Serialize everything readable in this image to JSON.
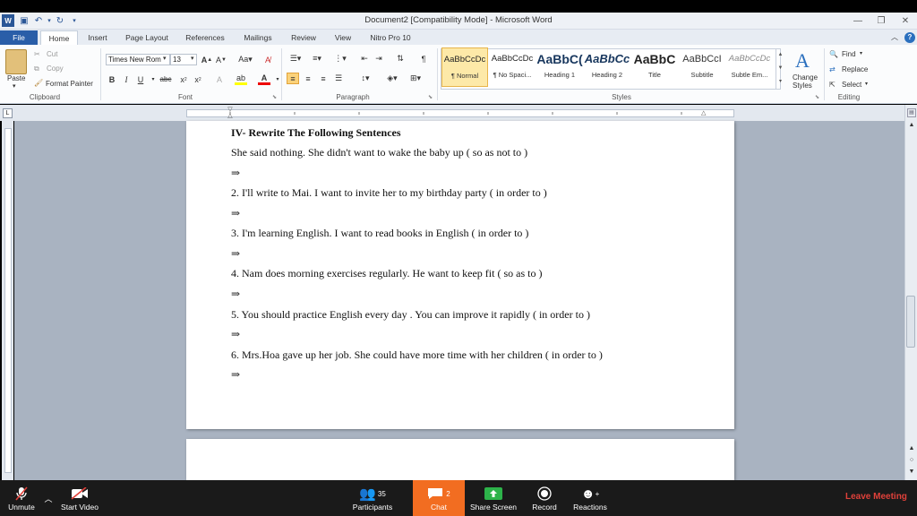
{
  "window": {
    "title": "Document2 [Compatibility Mode] - Microsoft Word"
  },
  "ribbon": {
    "tabs": [
      "File",
      "Home",
      "Insert",
      "Page Layout",
      "References",
      "Mailings",
      "Review",
      "View",
      "Nitro Pro 10"
    ],
    "clipboard": {
      "paste": "Paste",
      "cut": "Cut",
      "copy": "Copy",
      "format_painter": "Format Painter",
      "label": "Clipboard"
    },
    "font": {
      "name": "Times New Rom",
      "size": "13",
      "label": "Font"
    },
    "paragraph": {
      "label": "Paragraph"
    },
    "styles": {
      "label": "Styles",
      "items": [
        {
          "preview": "AaBbCcDc",
          "name": "¶ Normal"
        },
        {
          "preview": "AaBbCcDc",
          "name": "¶ No Spaci..."
        },
        {
          "preview": "AaBbC(",
          "name": "Heading 1"
        },
        {
          "preview": "AaBbCc",
          "name": "Heading 2"
        },
        {
          "preview": "AaBbC",
          "name": "Title"
        },
        {
          "preview": "AaBbCcI",
          "name": "Subtitle"
        },
        {
          "preview": "AaBbCcDc",
          "name": "Subtle Em..."
        }
      ],
      "change_styles_1": "Change",
      "change_styles_2": "Styles"
    },
    "editing": {
      "find": "Find",
      "replace": "Replace",
      "select": "Select",
      "label": "Editing"
    }
  },
  "document": {
    "heading": "IV- Rewrite The Following Sentences",
    "arrow": "⇒",
    "sentences": [
      "She said nothing. She didn't want to wake the baby up ( so as not to )",
      "2. I'll write to Mai. I want to invite her to my birthday party ( in order to )",
      "3. I'm learning English. I want to read books in English ( in order to )",
      "4. Nam does morning exercises regularly. He want to keep fit ( so as to )",
      "5. You should practice English every day . You can improve it rapidly ( in order to )",
      "6. Mrs.Hoa gave up her job. She could have more time with her children ( in order to )"
    ]
  },
  "meeting": {
    "unmute": "Unmute",
    "start_video": "Start Video",
    "participants": "Participants",
    "participants_count": "35",
    "chat": "Chat",
    "chat_count": "2",
    "share_screen": "Share Screen",
    "record": "Record",
    "reactions": "Reactions",
    "leave": "Leave Meeting",
    "accent_chat": "#f26d21",
    "accent_leave": "#e0413a",
    "accent_share": "#2db34a"
  }
}
